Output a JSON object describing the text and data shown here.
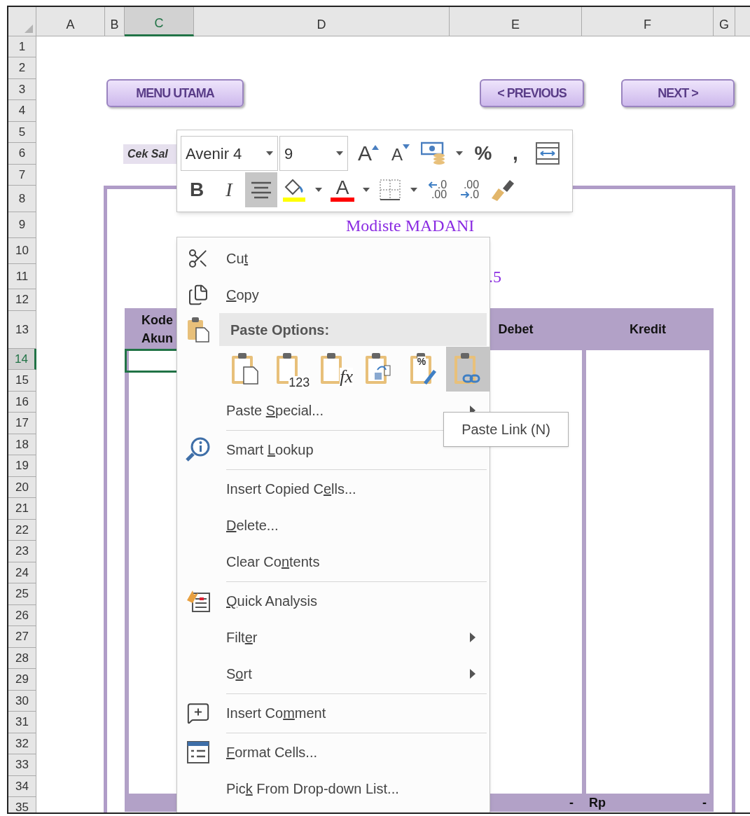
{
  "sheet": {
    "columns": [
      {
        "label": "A",
        "selected": false
      },
      {
        "label": "B",
        "selected": false
      },
      {
        "label": "C",
        "selected": true
      },
      {
        "label": "D",
        "selected": false
      },
      {
        "label": "E",
        "selected": false
      },
      {
        "label": "F",
        "selected": false
      },
      {
        "label": "G",
        "selected": false
      }
    ],
    "rows": [
      {
        "label": "1",
        "selected": false
      },
      {
        "label": "2",
        "selected": false
      },
      {
        "label": "3",
        "selected": false
      },
      {
        "label": "4",
        "selected": false
      },
      {
        "label": "5",
        "selected": false
      },
      {
        "label": "6",
        "selected": false
      },
      {
        "label": "7",
        "selected": false
      },
      {
        "label": "8",
        "selected": false
      },
      {
        "label": "9",
        "selected": false
      },
      {
        "label": "10",
        "selected": false
      },
      {
        "label": "11",
        "selected": false
      },
      {
        "label": "12",
        "selected": false
      },
      {
        "label": "13",
        "selected": false
      },
      {
        "label": "14",
        "selected": true
      },
      {
        "label": "15",
        "selected": false
      },
      {
        "label": "16",
        "selected": false
      },
      {
        "label": "17",
        "selected": false
      },
      {
        "label": "18",
        "selected": false
      },
      {
        "label": "19",
        "selected": false
      },
      {
        "label": "20",
        "selected": false
      },
      {
        "label": "21",
        "selected": false
      },
      {
        "label": "22",
        "selected": false
      },
      {
        "label": "23",
        "selected": false
      },
      {
        "label": "24",
        "selected": false
      },
      {
        "label": "25",
        "selected": false
      },
      {
        "label": "26",
        "selected": false
      },
      {
        "label": "27",
        "selected": false
      },
      {
        "label": "28",
        "selected": false
      },
      {
        "label": "29",
        "selected": false
      },
      {
        "label": "30",
        "selected": false
      },
      {
        "label": "31",
        "selected": false
      },
      {
        "label": "32",
        "selected": false
      },
      {
        "label": "33",
        "selected": false
      },
      {
        "label": "34",
        "selected": false
      },
      {
        "label": "35",
        "selected": false
      }
    ]
  },
  "nav_buttons": {
    "menu": "MENU UTAMA",
    "previous": "< PREVIOUS",
    "next": "NEXT >"
  },
  "check_label": "Cek Sal",
  "company": "Modiste MADANI",
  "period_fragment": ".5",
  "table": {
    "columns": [
      "Kode\nAkun",
      "Debet",
      "Kredit"
    ],
    "footer": {
      "debet": "-",
      "currency": "Rp",
      "kredit": "-"
    }
  },
  "mini_toolbar": {
    "font": "Avenir 4",
    "size": "9",
    "row1": [
      {
        "kind": "grow-font",
        "glyph": "A",
        "selected": false
      },
      {
        "kind": "shrink-font",
        "glyph": "A",
        "selected": false
      },
      {
        "kind": "accounting",
        "dropdown": true,
        "selected": false
      },
      {
        "kind": "text",
        "glyph": "%",
        "selected": false
      },
      {
        "kind": "text",
        "glyph": ",",
        "selected": false
      },
      {
        "kind": "wrap",
        "selected": false
      }
    ],
    "row2": [
      {
        "kind": "text",
        "glyph": "B",
        "selected": false
      },
      {
        "kind": "italic",
        "glyph": "I",
        "selected": false
      },
      {
        "kind": "align",
        "selected": true
      },
      {
        "kind": "fill",
        "color": "#ffff00",
        "dropdown": true,
        "selected": false
      },
      {
        "kind": "font-color",
        "glyph": "A",
        "color": "#ff0000",
        "dropdown": true,
        "selected": false
      },
      {
        "kind": "borders",
        "dropdown": true,
        "selected": false
      },
      {
        "kind": "increase-decimal",
        "top": ".0",
        "bottom": ".00",
        "selected": false
      },
      {
        "kind": "decrease-decimal",
        "top": ".00",
        "bottom": ".0",
        "selected": false
      },
      {
        "kind": "painter",
        "selected": false
      }
    ]
  },
  "context_menu": [
    {
      "kind": "item",
      "before": "Cu",
      "key": "t",
      "submenu": false
    },
    {
      "kind": "item",
      "key": "C",
      "after": "opy",
      "submenu": false
    },
    {
      "kind": "header",
      "text": "Paste Options:"
    },
    {
      "kind": "paste-options",
      "options": [
        {
          "selected": false
        },
        {
          "badge": "123",
          "selected": false
        },
        {
          "badge": "fx",
          "selected": false
        },
        {
          "selected": false
        },
        {
          "badge": "%",
          "selected": false
        },
        {
          "selected": true
        }
      ]
    },
    {
      "kind": "item",
      "before": "Paste ",
      "key": "S",
      "after": "pecial...",
      "submenu": true
    },
    {
      "kind": "separator"
    },
    {
      "kind": "item",
      "before": "Smart ",
      "key": "L",
      "after": "ookup",
      "submenu": false
    },
    {
      "kind": "separator"
    },
    {
      "kind": "item",
      "before": "Insert Copied C",
      "key": "e",
      "after": "lls...",
      "submenu": false
    },
    {
      "kind": "item",
      "key": "D",
      "after": "elete...",
      "submenu": false
    },
    {
      "kind": "item",
      "before": "Clear Co",
      "key": "n",
      "after": "tents",
      "submenu": false
    },
    {
      "kind": "separator"
    },
    {
      "kind": "item",
      "key": "Q",
      "after": "uick Analysis",
      "submenu": false
    },
    {
      "kind": "item",
      "before": "Filt",
      "key": "e",
      "after": "r",
      "submenu": true
    },
    {
      "kind": "item",
      "before": "S",
      "key": "o",
      "after": "rt",
      "submenu": true
    },
    {
      "kind": "separator"
    },
    {
      "kind": "item",
      "before": "Insert Co",
      "key": "m",
      "after": "ment",
      "submenu": false
    },
    {
      "kind": "separator"
    },
    {
      "kind": "item",
      "key": "F",
      "after": "ormat Cells...",
      "submenu": false
    },
    {
      "kind": "item",
      "before": "Pic",
      "key": "k",
      "after": " From Drop-down List...",
      "submenu": false
    }
  ],
  "tooltip": "Paste Link (N)"
}
